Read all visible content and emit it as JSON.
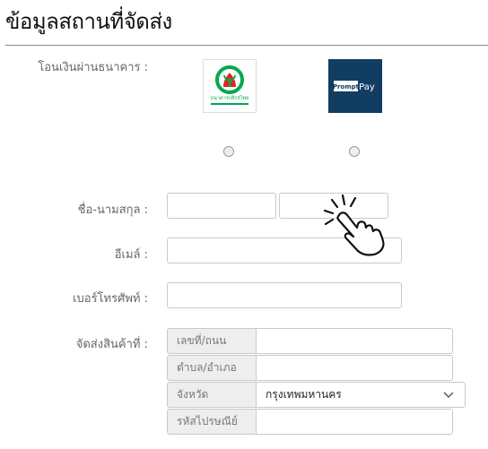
{
  "page": {
    "title": "ข้อมูลสถานที่จัดส่ง"
  },
  "payment": {
    "label": "โอนเงินผ่านธนาคาร :",
    "options": [
      {
        "name": "กสิกรไทย",
        "logo_text": "ธนาคารกสิกรไทย",
        "brand_color": "#00a950"
      },
      {
        "name": "PromptPay",
        "logo_text_a": "Prompt",
        "logo_text_b": "Pay",
        "brand_color": "#123d62"
      }
    ]
  },
  "form": {
    "name_label": "ชื่อ-นามสกุล :",
    "email_label": "อีเมล์ :",
    "phone_label": "เบอร์โทรศัพท์ :",
    "shipping_label": "จัดส่งสินค้าที่ :",
    "address": {
      "street_label": "เลขที่/ถนน",
      "subdistrict_label": "ตำบล/อำเภอ",
      "province_label": "จังหวัด",
      "province_value": "กรุงเทพมหานคร",
      "postcode_label": "รหัสไปรษณีย์"
    }
  },
  "icons": {
    "cursor": "pointer-hand-click-icon",
    "dropdown": "chevron-down-icon"
  }
}
